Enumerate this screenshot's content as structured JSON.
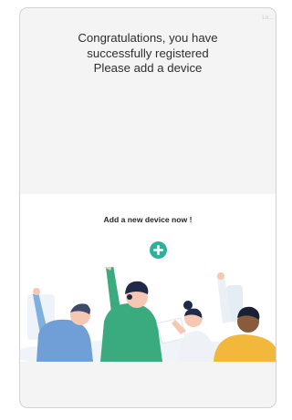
{
  "header": {
    "corner_link": "Lo..."
  },
  "welcome": {
    "line1": "Congratulations, you have",
    "line2": "successfully registered",
    "line3": "Please add a device"
  },
  "add_device": {
    "title": "Add a new device now !",
    "icon": "plus-icon",
    "button_color": "#2db19a"
  },
  "illustration": {
    "icon": "people-waving-illustration"
  }
}
